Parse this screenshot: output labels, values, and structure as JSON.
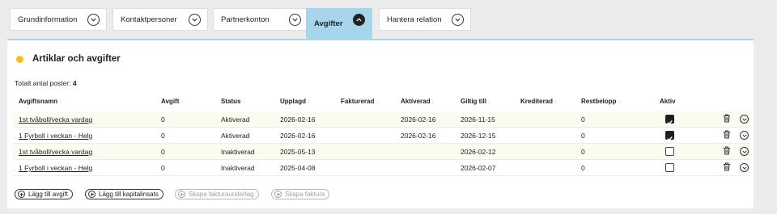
{
  "tabs": [
    {
      "label": "Grundinformation",
      "expanded": false
    },
    {
      "label": "Kontaktpersoner",
      "expanded": false
    },
    {
      "label": "Partnerkonton",
      "expanded": false
    },
    {
      "label": "Avgifter",
      "expanded": true
    },
    {
      "label": "Hantera relation",
      "expanded": false
    }
  ],
  "panel": {
    "title": "Artiklar och avgifter",
    "total_label": "Totalt antal poster:",
    "total_count": "4",
    "status_dot_color": "#f3c21a"
  },
  "table": {
    "columns": [
      "Avgiftsnamn",
      "Avgift",
      "Status",
      "Upplagd",
      "Fakturerad",
      "Aktiverad",
      "Giltig till",
      "Krediterad",
      "Restbelopp",
      "Aktiv"
    ],
    "sort_glyph": "↕",
    "rows": [
      {
        "name": "1st tvåboll/vecka vardag",
        "avgift": "0",
        "status": "Aktiverad",
        "upplagd": "2026-02-16",
        "fakturerad": "",
        "aktiverad": "2026-02-16",
        "giltig_till": "2026-11-15",
        "krediterad": "",
        "restbelopp": "0",
        "aktiv": true
      },
      {
        "name": "1 Fyrboll i veckan - Helg",
        "avgift": "0",
        "status": "Aktiverad",
        "upplagd": "2026-02-16",
        "fakturerad": "",
        "aktiverad": "2026-02-16",
        "giltig_till": "2026-12-15",
        "krediterad": "",
        "restbelopp": "0",
        "aktiv": true
      },
      {
        "name": "1st tvåboll/vecka vardag",
        "avgift": "0",
        "status": "Inaktiverad",
        "upplagd": "2025-05-13",
        "fakturerad": "",
        "aktiverad": "",
        "giltig_till": "2026-02-12",
        "krediterad": "",
        "restbelopp": "0",
        "aktiv": false
      },
      {
        "name": "1 Fyrboll i veckan - Helg",
        "avgift": "0",
        "status": "Inaktiverad",
        "upplagd": "2025-04-08",
        "fakturerad": "",
        "aktiverad": "",
        "giltig_till": "2026-02-07",
        "krediterad": "",
        "restbelopp": "0",
        "aktiv": false
      }
    ]
  },
  "actions": [
    {
      "label": "Lägg till avgift",
      "enabled": true
    },
    {
      "label": "Lägg till kapitalinsats",
      "enabled": true
    },
    {
      "label": "Skapa fakturaunderlag",
      "enabled": false
    },
    {
      "label": "Skapa faktura",
      "enabled": false
    }
  ],
  "colors": {
    "accent": "#a6d5ec",
    "row_alt": "#fcfbef"
  }
}
